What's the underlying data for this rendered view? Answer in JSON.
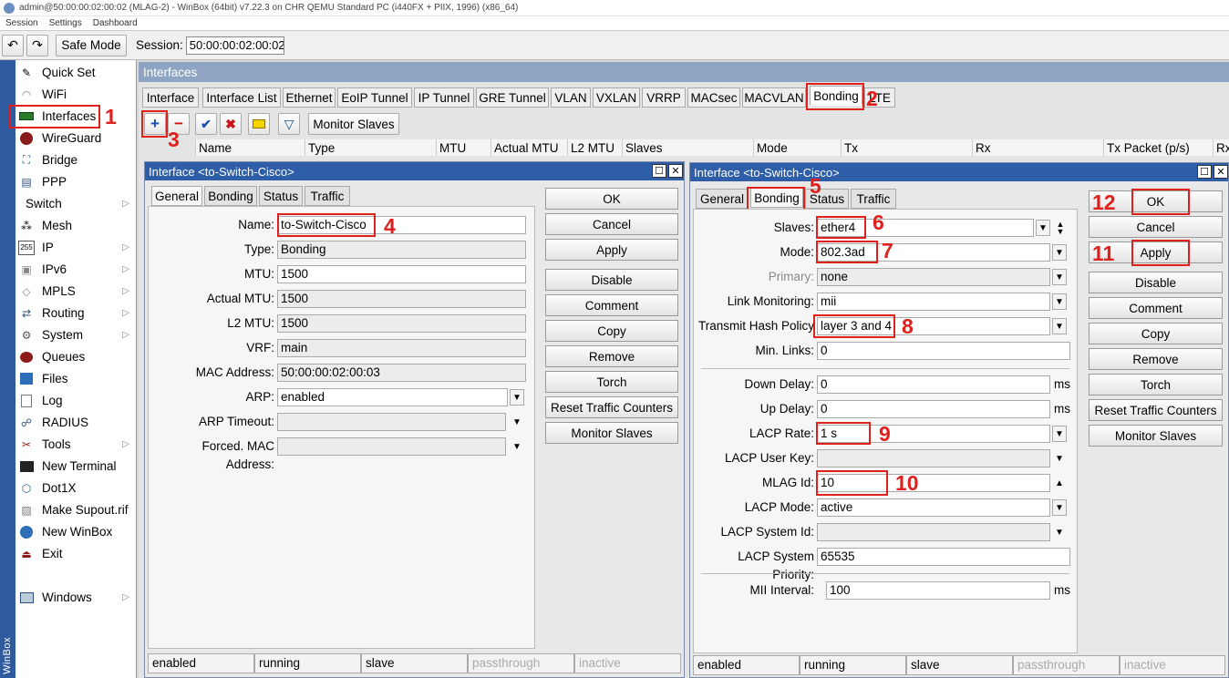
{
  "window": {
    "title": "admin@50:00:00:02:00:02 (MLAG-2) - WinBox (64bit) v7.22.3 on CHR QEMU Standard PC (i440FX + PIIX, 1996) (x86_64)"
  },
  "menu": [
    "Session",
    "Settings",
    "Dashboard"
  ],
  "toolbar": {
    "undo_icon": "undo-icon",
    "redo_icon": "redo-icon",
    "safe_mode": "Safe Mode",
    "session_label": "Session:",
    "session_value": "50:00:00:02:00:02"
  },
  "sidebar": {
    "brand": "WinBox",
    "items": [
      {
        "label": "Quick Set",
        "icon": "wand-icon"
      },
      {
        "label": "WiFi",
        "icon": "wifi-icon"
      },
      {
        "label": "Interfaces",
        "icon": "interfaces-icon"
      },
      {
        "label": "WireGuard",
        "icon": "wireguard-icon"
      },
      {
        "label": "Bridge",
        "icon": "bridge-icon"
      },
      {
        "label": "PPP",
        "icon": "ppp-icon"
      },
      {
        "label": "Switch",
        "icon": "switch-icon"
      },
      {
        "label": "Mesh",
        "icon": "mesh-icon"
      },
      {
        "label": "IP",
        "icon": "ip-icon"
      },
      {
        "label": "IPv6",
        "icon": "ipv6-icon"
      },
      {
        "label": "MPLS",
        "icon": "mpls-icon"
      },
      {
        "label": "Routing",
        "icon": "routing-icon"
      },
      {
        "label": "System",
        "icon": "gear-icon"
      },
      {
        "label": "Queues",
        "icon": "queues-icon"
      },
      {
        "label": "Files",
        "icon": "folder-icon"
      },
      {
        "label": "Log",
        "icon": "log-icon"
      },
      {
        "label": "RADIUS",
        "icon": "radius-icon"
      },
      {
        "label": "Tools",
        "icon": "tools-icon"
      },
      {
        "label": "New Terminal",
        "icon": "terminal-icon"
      },
      {
        "label": "Dot1X",
        "icon": "dot1x-icon"
      },
      {
        "label": "Make Supout.rif",
        "icon": "supout-icon"
      },
      {
        "label": "New WinBox",
        "icon": "winbox-icon"
      },
      {
        "label": "Exit",
        "icon": "exit-icon"
      },
      {
        "label": "Windows",
        "icon": "windows-icon"
      }
    ]
  },
  "interfaces": {
    "title": "Interfaces",
    "tabs": [
      "Interface",
      "Interface List",
      "Ethernet",
      "EoIP Tunnel",
      "IP Tunnel",
      "GRE Tunnel",
      "VLAN",
      "VXLAN",
      "VRRP",
      "MACsec",
      "MACVLAN",
      "Bonding",
      "LTE"
    ],
    "active_tab": "Bonding",
    "monitor_slaves": "Monitor Slaves",
    "columns": [
      "Name",
      "Type",
      "MTU",
      "Actual MTU",
      "L2 MTU",
      "Slaves",
      "Mode",
      "Tx",
      "Rx",
      "Tx Packet (p/s)",
      "Rx"
    ]
  },
  "dialog1": {
    "title": "Interface <to-Switch-Cisco>",
    "tabs": [
      "General",
      "Bonding",
      "Status",
      "Traffic"
    ],
    "active_tab": "General",
    "fields": [
      {
        "label": "Name:",
        "value": "to-Switch-Cisco"
      },
      {
        "label": "Type:",
        "value": "Bonding"
      },
      {
        "label": "MTU:",
        "value": "1500"
      },
      {
        "label": "Actual MTU:",
        "value": "1500"
      },
      {
        "label": "L2 MTU:",
        "value": "1500"
      },
      {
        "label": "VRF:",
        "value": "main"
      },
      {
        "label": "MAC Address:",
        "value": "50:00:00:02:00:03"
      },
      {
        "label": "ARP:",
        "value": "enabled"
      },
      {
        "label": "ARP Timeout:",
        "value": ""
      },
      {
        "label": "Forced. MAC Address:",
        "value": ""
      }
    ],
    "buttons": [
      "OK",
      "Cancel",
      "Apply",
      "Disable",
      "Comment",
      "Copy",
      "Remove",
      "Torch",
      "Reset Traffic Counters",
      "Monitor Slaves"
    ],
    "status": [
      "enabled",
      "running",
      "slave",
      "passthrough",
      "inactive"
    ]
  },
  "dialog2": {
    "title": "Interface <to-Switch-Cisco>",
    "tabs": [
      "General",
      "Bonding",
      "Status",
      "Traffic"
    ],
    "active_tab": "Bonding",
    "fields": [
      {
        "label": "Slaves:",
        "value": "ether4"
      },
      {
        "label": "Mode:",
        "value": "802.3ad"
      },
      {
        "label": "Primary:",
        "value": "none"
      },
      {
        "label": "Link Monitoring:",
        "value": "mii"
      },
      {
        "label": "Transmit Hash Policy",
        "value": "layer 3 and 4"
      },
      {
        "label": "Min. Links:",
        "value": "0"
      },
      {
        "label": "Down Delay:",
        "value": "0",
        "unit": "ms"
      },
      {
        "label": "Up Delay:",
        "value": "0",
        "unit": "ms"
      },
      {
        "label": "LACP Rate:",
        "value": "1 s"
      },
      {
        "label": "LACP User Key:",
        "value": ""
      },
      {
        "label": "MLAG Id:",
        "value": "10"
      },
      {
        "label": "LACP Mode:",
        "value": "active"
      },
      {
        "label": "LACP System Id:",
        "value": ""
      },
      {
        "label": "LACP System Priority:",
        "value": "65535"
      },
      {
        "label": "MII Interval:",
        "value": "100",
        "unit": "ms"
      }
    ],
    "buttons": [
      "OK",
      "Cancel",
      "Apply",
      "Disable",
      "Comment",
      "Copy",
      "Remove",
      "Torch",
      "Reset Traffic Counters",
      "Monitor Slaves"
    ],
    "status": [
      "enabled",
      "running",
      "slave",
      "passthrough",
      "inactive"
    ]
  },
  "annotations": [
    "1",
    "2",
    "3",
    "4",
    "5",
    "6",
    "7",
    "8",
    "9",
    "10",
    "11",
    "12"
  ],
  "colors": {
    "annotation": "#e0201c",
    "dialog_title": "#2e5ea8",
    "panel_title": "#8ea4c2"
  }
}
